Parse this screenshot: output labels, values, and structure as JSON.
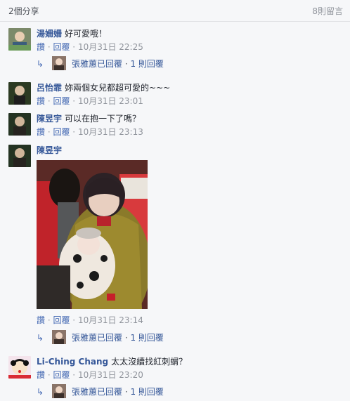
{
  "header": {
    "shares": "2個分享",
    "comment_count": "8則留言"
  },
  "actions": {
    "like": "讚",
    "reply": "回覆",
    "sep": " · "
  },
  "comments": [
    {
      "author": "湯姍姍",
      "text": "好可愛哦！",
      "time": "10月31日 22:25",
      "reply": {
        "by": "張雅蕙已回覆",
        "count": "1 則回覆"
      }
    },
    {
      "author": "呂怡霏",
      "text": "妳兩個女兒都超可愛的~~~",
      "time": "10月31日 23:01"
    },
    {
      "author": "陳昱宇",
      "text": "可以在抱一下了嗎？",
      "time": "10月31日 23:13"
    },
    {
      "author": "陳昱宇",
      "text": "",
      "time": "10月31日 23:14",
      "reply": {
        "by": "張雅蕙已回覆",
        "count": "1 則回覆"
      }
    },
    {
      "author": "Li-Ching Chang",
      "text": "太太沒續找紅刺蝟？",
      "time": "10月31日 23:20",
      "reply": {
        "by": "張雅蕙已回覆",
        "count": "1 則回覆"
      }
    }
  ]
}
